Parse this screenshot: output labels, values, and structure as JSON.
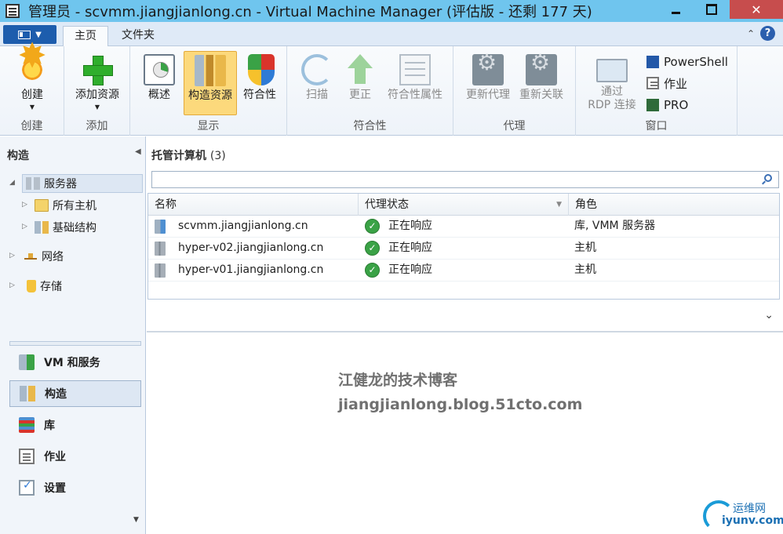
{
  "window": {
    "title": "管理员 - scvmm.jiangjianlong.cn - Virtual Machine Manager (评估版 - 还剩 177 天)",
    "minimize_glyph": "",
    "close_glyph": "✕"
  },
  "ribbon": {
    "tabs": [
      {
        "label": "主页",
        "active": true
      },
      {
        "label": "文件夹",
        "active": false
      }
    ],
    "minimize_glyph": "⌃",
    "help_glyph": "?",
    "groups": {
      "create": {
        "label": "创建",
        "buttons": [
          {
            "label": "创建",
            "icon": "create-icon",
            "has_dropdown": true
          }
        ]
      },
      "add": {
        "label": "添加",
        "buttons": [
          {
            "label": "添加资源",
            "icon": "add-resources-icon",
            "has_dropdown": true
          }
        ]
      },
      "show": {
        "label": "显示",
        "buttons": [
          {
            "label": "概述",
            "icon": "overview-icon"
          },
          {
            "label": "构造资源",
            "icon": "fabric-resources-icon",
            "selected": true
          },
          {
            "label": "符合性",
            "icon": "compliance-icon"
          }
        ]
      },
      "compliance": {
        "label": "符合性",
        "buttons": [
          {
            "label": "扫描",
            "icon": "scan-icon",
            "disabled": true
          },
          {
            "label": "更正",
            "icon": "remediate-icon",
            "disabled": true
          },
          {
            "label": "符合性属性",
            "icon": "compliance-properties-icon",
            "disabled": true
          }
        ]
      },
      "agent": {
        "label": "代理",
        "buttons": [
          {
            "label": "更新代理",
            "icon": "update-agent-icon",
            "disabled": true
          },
          {
            "label": "重新关联",
            "icon": "reassociate-icon",
            "disabled": true
          }
        ]
      },
      "window": {
        "label": "窗口",
        "rdp": {
          "line1": "通过",
          "line2": "RDP 连接",
          "icon": "rdp-icon",
          "disabled": true
        },
        "small_buttons": [
          {
            "label": "PowerShell",
            "icon": "powershell-icon"
          },
          {
            "label": "作业",
            "icon": "jobs-icon"
          },
          {
            "label": "PRO",
            "icon": "pro-icon"
          }
        ]
      }
    }
  },
  "left_pane": {
    "title": "构造",
    "collapse_glyph": "◀",
    "tree": [
      {
        "label": "服务器",
        "icon": "servers-icon",
        "selected": true,
        "expanded": true
      },
      {
        "label": "所有主机",
        "icon": "folder-icon"
      },
      {
        "label": "基础结构",
        "icon": "infrastructure-icon"
      },
      {
        "label": "网络",
        "icon": "networking-icon"
      },
      {
        "label": "存储",
        "icon": "storage-icon"
      }
    ],
    "workspaces": [
      {
        "label": "VM 和服务",
        "icon": "vms-and-services-icon"
      },
      {
        "label": "构造",
        "icon": "fabric-icon",
        "selected": true
      },
      {
        "label": "库",
        "icon": "library-icon"
      },
      {
        "label": "作业",
        "icon": "jobs-icon"
      },
      {
        "label": "设置",
        "icon": "settings-icon"
      }
    ],
    "more_glyph": "▼"
  },
  "main": {
    "title": "托管计算机",
    "count": "(3)",
    "search": {
      "value": "",
      "placeholder": ""
    },
    "columns": [
      "名称",
      "代理状态",
      "角色"
    ],
    "rows": [
      {
        "name": "scvmm.jiangjianlong.cn",
        "status": "正在响应",
        "role": "库, VMM 服务器",
        "icon": "vmm-server-icon"
      },
      {
        "name": "hyper-v02.jiangjianlong.cn",
        "status": "正在响应",
        "role": "主机",
        "icon": "host-icon"
      },
      {
        "name": "hyper-v01.jiangjianlong.cn",
        "status": "正在响应",
        "role": "主机",
        "icon": "host-icon"
      }
    ],
    "details_caret": "⌄",
    "watermark": {
      "line1": "江健龙的技术博客",
      "line2": "jiangjianlong.blog.51cto.com"
    }
  },
  "corner_logo": {
    "line1": "运维网",
    "line2": "iyunv.com"
  },
  "colors": {
    "titlebar": "#6fc5ee",
    "accent": "#1d5dad",
    "selected_button": "#fcd97c",
    "ok_green": "#3aa246"
  }
}
